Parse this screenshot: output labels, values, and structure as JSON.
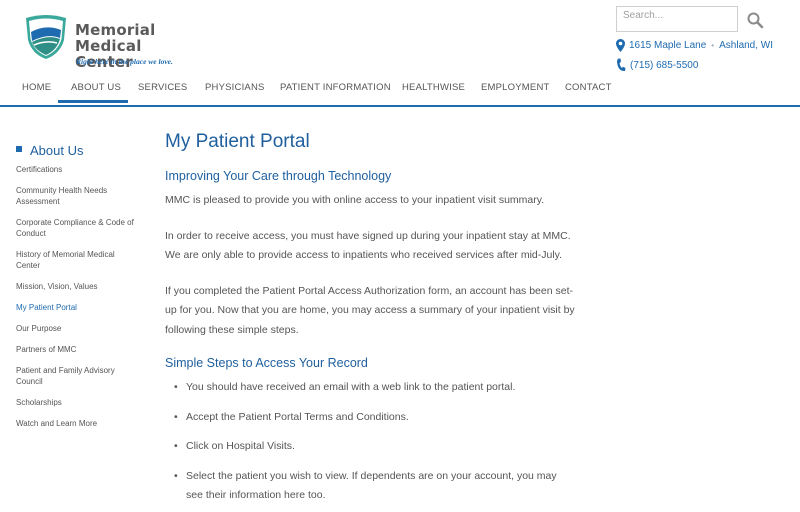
{
  "header": {
    "logo_line1": "Memorial",
    "logo_line2": "Medical Center",
    "tagline": "Right here in the place we love.",
    "search_placeholder": "Search...",
    "address_street": "1615 Maple Lane",
    "address_city": "Ashland, WI",
    "phone": "(715) 685-5500",
    "colors": {
      "brand_blue": "#1f6bb0",
      "brand_teal": "#3aa89a",
      "dark_text": "#5a5a5a"
    }
  },
  "nav": {
    "items": [
      {
        "label": "HOME"
      },
      {
        "label": "ABOUT US"
      },
      {
        "label": "SERVICES"
      },
      {
        "label": "PHYSICIANS"
      },
      {
        "label": "PATIENT INFORMATION"
      },
      {
        "label": "HEALTHWISE"
      },
      {
        "label": "EMPLOYMENT"
      },
      {
        "label": "CONTACT"
      }
    ],
    "active": "ABOUT US"
  },
  "sidebar": {
    "heading": "About Us",
    "items": [
      {
        "label": "Certifications"
      },
      {
        "label": "Community Health Needs Assessment"
      },
      {
        "label": "Corporate Compliance & Code of Conduct"
      },
      {
        "label": "History of Memorial Medical Center"
      },
      {
        "label": "Mission, Vision, Values"
      },
      {
        "label": "My Patient Portal"
      },
      {
        "label": "Our Purpose"
      },
      {
        "label": "Partners of MMC"
      },
      {
        "label": "Patient and Family Advisory Council"
      },
      {
        "label": "Scholarships"
      },
      {
        "label": "Watch and Learn More"
      }
    ],
    "current": "My Patient Portal"
  },
  "main": {
    "title": "My Patient Portal",
    "section1_title": "Improving Your Care through Technology",
    "paragraphs": [
      "MMC is pleased to provide you with online access to your inpatient visit summary.",
      "In order to receive access, you must have signed up during your inpatient stay at MMC. We are only able to provide access to inpatients who received services after mid-July.",
      "If you completed the Patient Portal Access Authorization form, an account has been set-up for you. Now that you are home, you may access a summary of your inpatient visit by following these simple steps."
    ],
    "section2_title": "Simple Steps to Access Your Record",
    "steps": [
      "You should have received an email with a web link to the patient portal.",
      "Accept the Patient Portal Terms and Conditions.",
      "Click on Hospital Visits.",
      "Select the patient you wish to view. If dependents are on your account, you may see their information here too."
    ]
  }
}
